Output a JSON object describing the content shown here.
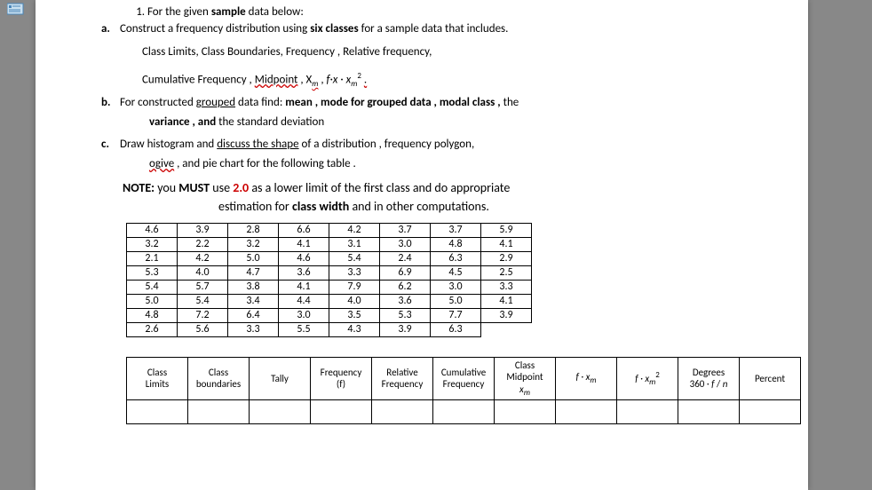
{
  "q1": {
    "t1": "For the given",
    "t2": "sample",
    "t3": "data below:"
  },
  "a": {
    "lbl": "a.",
    "t1": "Construct a frequency distribution using",
    "t2": "six classes",
    "t3": "for a sample data that includes.",
    "line2": "Class Limits, Class Boundaries, Frequency , Relative frequency,",
    "l3a": "Cumulative Frequency ,",
    "l3b": "Midpoint",
    "l3c": "X",
    "sub": "m",
    "l3d": "f·x"
  },
  "b": {
    "lbl": "b.",
    "t1": "For constructed",
    "t2": "grouped",
    "t3": "data find:",
    "t4": "mean , mode for grouped data , modal class ,",
    "t5": "the",
    "l2a": "variance , and",
    "l2b": "the standard deviation"
  },
  "c": {
    "lbl": "c.",
    "t1": "Draw histogram and",
    "t2": "discuss the shape",
    "t3": "of a distribution , frequency polygon,",
    "l2a": "ogive",
    "l2b": ", and pie chart for the following table ."
  },
  "note": {
    "p1": "NOTE:",
    "p2": "you",
    "p3": "MUST",
    "p4": "use",
    "p5": "2.0",
    "p6": "as a lower limit of the first class and do appropriate",
    "p7": "estimation for",
    "p8": "class width",
    "p9": "and in other computations."
  },
  "data_rows": [
    [
      "4.6",
      "3.9",
      "2.8",
      "6.6",
      "4.2",
      "3.7",
      "3.7",
      "5.9"
    ],
    [
      "3.2",
      "2.2",
      "3.2",
      "4.1",
      "3.1",
      "3.0",
      "4.8",
      "4.1"
    ],
    [
      "2.1",
      "4.2",
      "5.0",
      "4.6",
      "5.4",
      "2.4",
      "6.3",
      "2.9"
    ],
    [
      "5.3",
      "4.0",
      "4.7",
      "3.6",
      "3.3",
      "6.9",
      "4.5",
      "2.5"
    ],
    [
      "5.4",
      "5.7",
      "3.8",
      "4.1",
      "7.9",
      "6.2",
      "3.0",
      "3.3"
    ],
    [
      "5.0",
      "5.4",
      "3.4",
      "4.4",
      "4.0",
      "3.6",
      "5.0",
      "4.1"
    ],
    [
      "4.8",
      "7.2",
      "6.4",
      "3.0",
      "3.5",
      "5.3",
      "7.7",
      "3.9"
    ],
    [
      "2.6",
      "5.6",
      "3.3",
      "5.5",
      "4.3",
      "3.9",
      "6.3",
      ""
    ]
  ],
  "headers": [
    {
      "html": "Class<br>Limits"
    },
    {
      "html": "Class<br>boundaries"
    },
    {
      "html": "Tally"
    },
    {
      "html": "Frequency<br>(f)"
    },
    {
      "html": "Relative<br>Frequency"
    },
    {
      "html": "Cumulative<br>Frequency"
    },
    {
      "html": "Class<br>Midpoint<br><i>x<sub>m</sub></i>"
    },
    {
      "html": "<i>f · x<sub>m</sub></i>"
    },
    {
      "html": "<i>f · x<sub>m</sub></i><sup>2</sup>"
    },
    {
      "html": "Degrees<br>360 · <i>f</i> / <i>n</i>"
    },
    {
      "html": "Percent"
    }
  ]
}
